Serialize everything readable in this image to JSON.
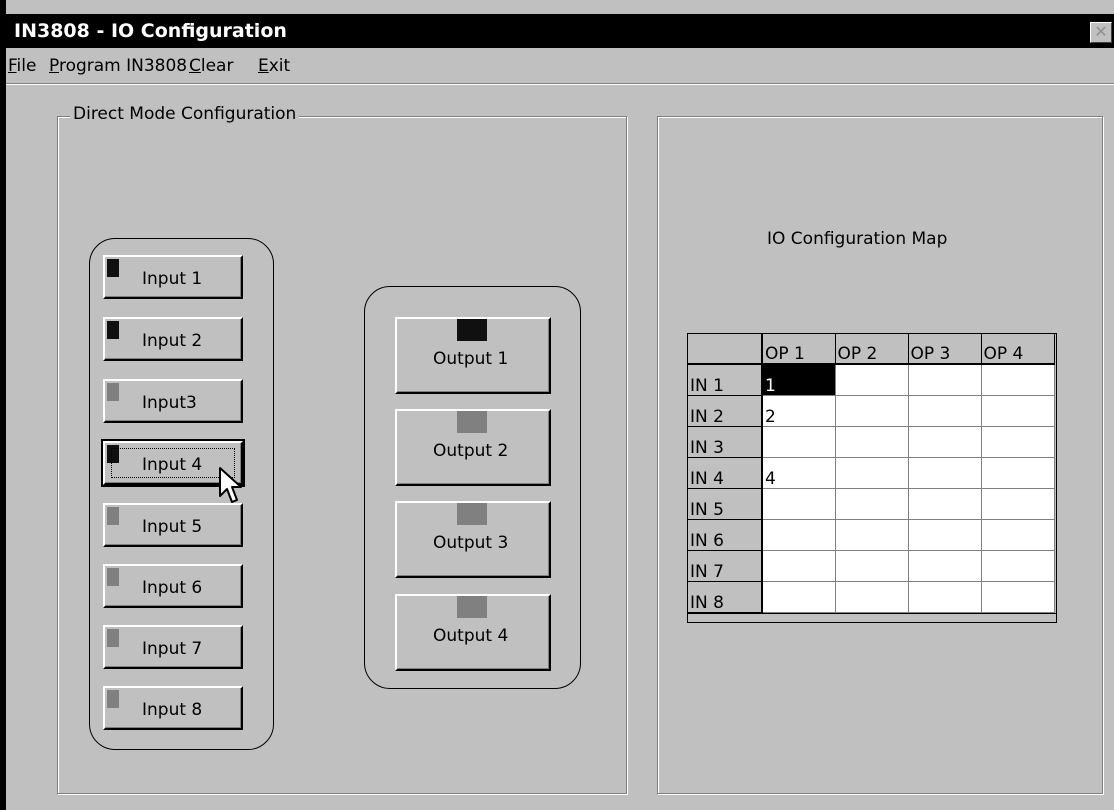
{
  "window": {
    "title": "IN3808 - IO Configuration",
    "close_glyph": "✕"
  },
  "menu": {
    "items": [
      {
        "pre": "",
        "u": "F",
        "post": "ile"
      },
      {
        "pre": "",
        "u": "P",
        "post": "rogram IN3808"
      },
      {
        "pre": "",
        "u": "C",
        "post": "lear"
      },
      {
        "pre": "",
        "u": "E",
        "post": "xit"
      }
    ]
  },
  "direct_mode": {
    "group_label": "Direct Mode Configuration",
    "inputs": [
      {
        "label": "Input 1",
        "active": true
      },
      {
        "label": "Input 2",
        "active": true
      },
      {
        "label": "Input3",
        "active": false
      },
      {
        "label": "Input 4",
        "active": true,
        "focused": true
      },
      {
        "label": "Input 5",
        "active": false
      },
      {
        "label": "Input 6",
        "active": false
      },
      {
        "label": "Input 7",
        "active": false
      },
      {
        "label": "Input 8",
        "active": false
      }
    ],
    "outputs": [
      {
        "label": "Output 1",
        "active": true
      },
      {
        "label": "Output 2",
        "active": false
      },
      {
        "label": "Output 3",
        "active": false
      },
      {
        "label": "Output 4",
        "active": false
      }
    ]
  },
  "io_map": {
    "title": "IO Configuration Map",
    "columns": [
      "OP 1",
      "OP 2",
      "OP 3",
      "OP 4"
    ],
    "rows": [
      {
        "label": "IN 1",
        "cells": [
          "1",
          "",
          "",
          ""
        ],
        "selected_col": 0
      },
      {
        "label": "IN 2",
        "cells": [
          "2",
          "",
          "",
          ""
        ]
      },
      {
        "label": "IN 3",
        "cells": [
          "",
          "",
          "",
          ""
        ]
      },
      {
        "label": "IN 4",
        "cells": [
          "4",
          "",
          "",
          ""
        ]
      },
      {
        "label": "IN 5",
        "cells": [
          "",
          "",
          "",
          ""
        ]
      },
      {
        "label": "IN 6",
        "cells": [
          "",
          "",
          "",
          ""
        ]
      },
      {
        "label": "IN 7",
        "cells": [
          "",
          "",
          "",
          ""
        ]
      },
      {
        "label": "IN 8",
        "cells": [
          "",
          "",
          "",
          ""
        ]
      }
    ]
  },
  "colors": {
    "active_indicator": "#101010",
    "inactive_indicator": "#808080",
    "face": "#c0c0c0"
  },
  "cursor": {
    "icon": "arrow-cursor-icon"
  }
}
